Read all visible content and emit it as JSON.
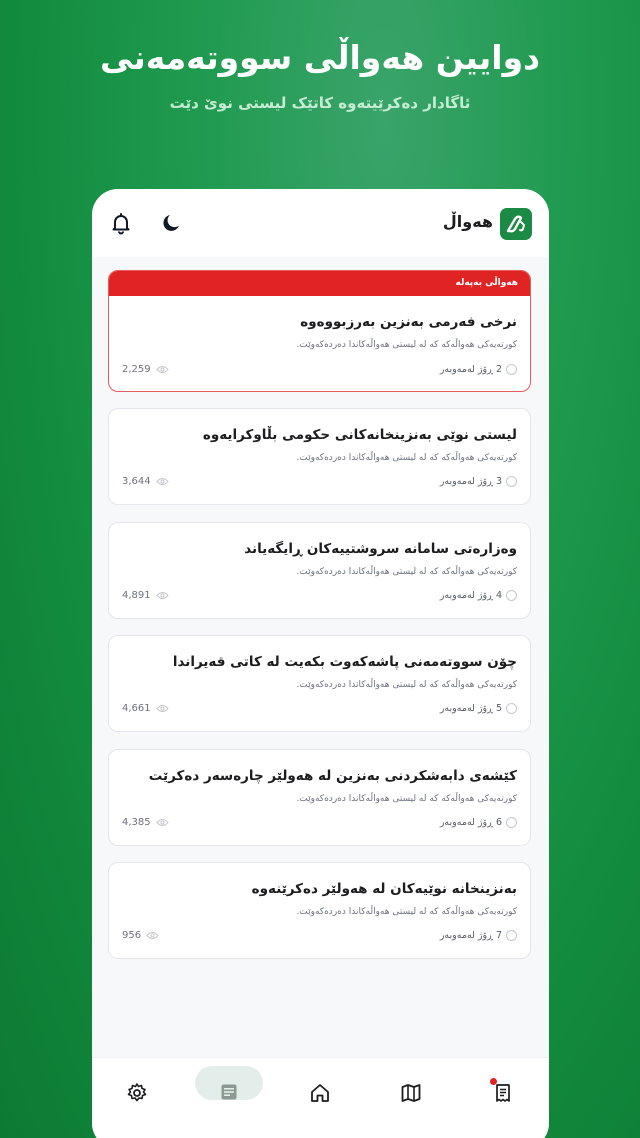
{
  "hero": {
    "title": "دوایین هەواڵی سووتەمەنی",
    "subtitle": "ئاگادار دەکرێیتەوە کاتێک لیستی نوێ دێت"
  },
  "app": {
    "title": "هەواڵ",
    "brand_color": "#1a8a45",
    "urgent_color": "#e02424"
  },
  "icons": {
    "logo": "fuel-pump-icon",
    "bell": "bell-icon",
    "theme": "moon-icon"
  },
  "news": [
    {
      "badge": "هەواڵی بەپەلە",
      "title": "نرخی فەرمی بەنزین بەرزبووەوە",
      "desc": "کورتەیەکی هەواڵەکە کە لە لیستی هەواڵەکاندا دەردەکەوێت.",
      "time": "2 ڕۆژ لەمەوبەر",
      "views": "2,259",
      "urgent": true
    },
    {
      "title": "لیستی نوێی بەنزینخانەکانی حکومی بڵاوکرایەوە",
      "desc": "کورتەیەکی هەواڵەکە کە لە لیستی هەواڵەکاندا دەردەکەوێت.",
      "time": "3 ڕۆژ لەمەوبەر",
      "views": "3,644"
    },
    {
      "title": "وەزارەتی سامانە سروشتییەکان ڕایگەیاند",
      "desc": "کورتەیەکی هەواڵەکە کە لە لیستی هەواڵەکاندا دەردەکەوێت.",
      "time": "4 ڕۆژ لەمەوبەر",
      "views": "4,891"
    },
    {
      "title": "چۆن سووتەمەنی پاشەکەوت بکەیت لە کاتی قەیراندا",
      "desc": "کورتەیەکی هەواڵەکە کە لە لیستی هەواڵەکاندا دەردەکەوێت.",
      "time": "5 ڕۆژ لەمەوبەر",
      "views": "4,661"
    },
    {
      "title": "کێشەی دابەشکردنی بەنزین لە هەولێر چارەسەر دەکرێت",
      "desc": "کورتەیەکی هەواڵەکە کە لە لیستی هەواڵەکاندا دەردەکەوێت.",
      "time": "6 ڕۆژ لەمەوبەر",
      "views": "4,385"
    },
    {
      "title": "بەنزینخانە نوێیەکان لە هەولێر دەکرێنەوە",
      "desc": "کورتەیەکی هەواڵەکە کە لە لیستی هەواڵەکاندا دەردەکەوێت.",
      "time": "7 ڕۆژ لەمەوبەر",
      "views": "956"
    }
  ],
  "bottom_nav": {
    "items": [
      {
        "icon": "document-list-icon",
        "has_badge": true
      },
      {
        "icon": "map-icon"
      },
      {
        "icon": "home-icon"
      },
      {
        "icon": "newspaper-icon",
        "active": true
      },
      {
        "icon": "gear-icon"
      }
    ]
  }
}
